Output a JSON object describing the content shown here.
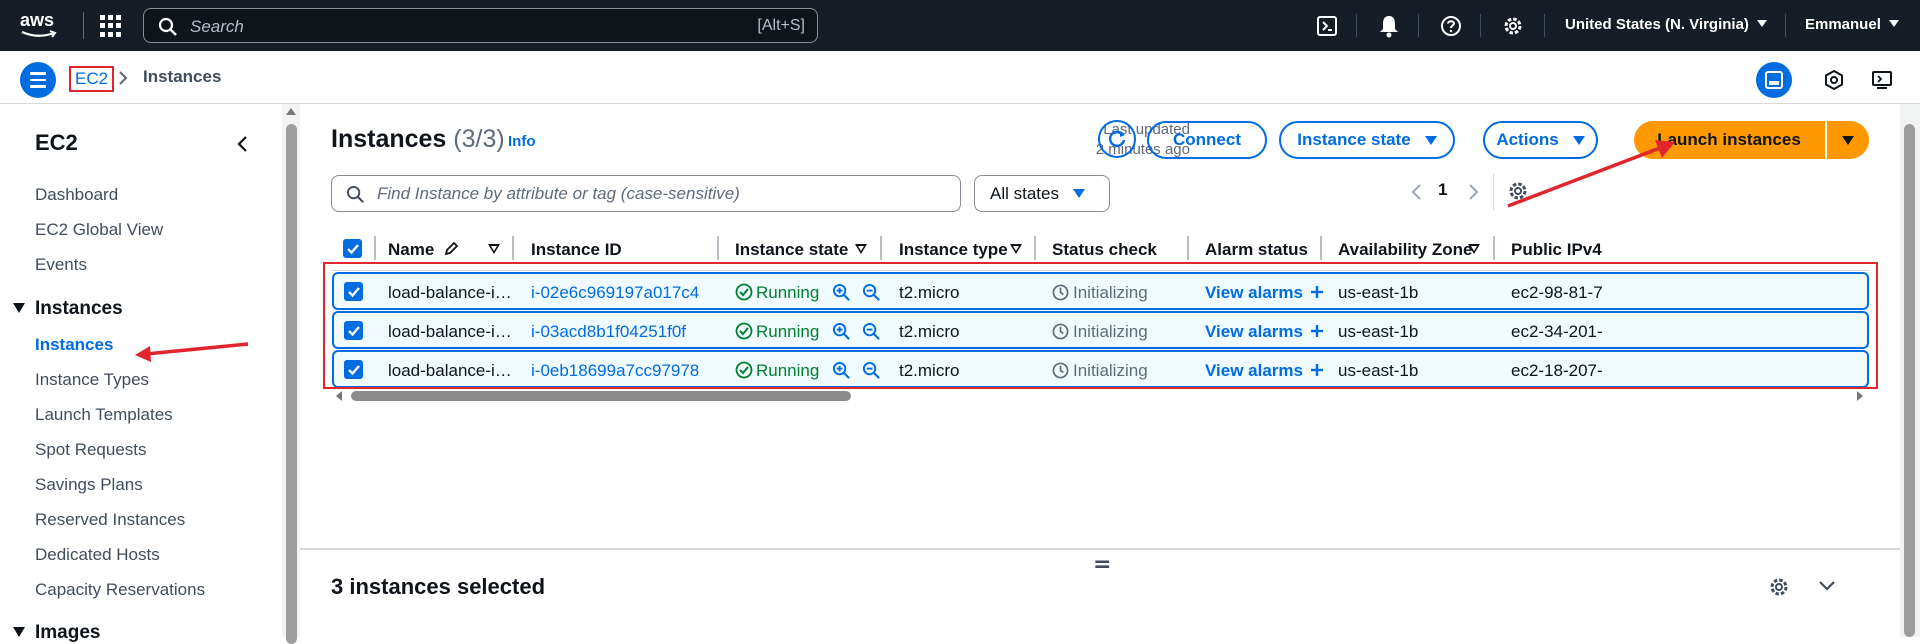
{
  "topbar": {
    "logo_text": "aws",
    "search_placeholder": "Search",
    "search_shortcut": "[Alt+S]",
    "region": "United States (N. Virginia)",
    "user": "Emmanuel"
  },
  "breadcrumb": {
    "service": "EC2",
    "current": "Instances"
  },
  "sidebar": {
    "title": "EC2",
    "items_top": [
      "Dashboard",
      "EC2 Global View",
      "Events"
    ],
    "section_instances": "Instances",
    "instances_items": [
      "Instances",
      "Instance Types",
      "Launch Templates",
      "Spot Requests",
      "Savings Plans",
      "Reserved Instances",
      "Dedicated Hosts",
      "Capacity Reservations"
    ],
    "section_images": "Images"
  },
  "header": {
    "title": "Instances",
    "count": "(3/3)",
    "info": "Info",
    "last_updated_line1": "Last updated",
    "last_updated_line2": "2 minutes ago",
    "connect": "Connect",
    "instance_state": "Instance state",
    "actions": "Actions",
    "launch": "Launch instances"
  },
  "filter": {
    "placeholder": "Find Instance by attribute or tag (case-sensitive)",
    "states": "All states"
  },
  "pagination": {
    "page": "1"
  },
  "table": {
    "columns": [
      "Name",
      "Instance ID",
      "Instance state",
      "Instance type",
      "Status check",
      "Alarm status",
      "Availability Zone",
      "Public IPv4"
    ],
    "rows": [
      {
        "name": "load-balance-i…",
        "id": "i-02e6c969197a017c4",
        "state": "Running",
        "type": "t2.micro",
        "status": "Initializing",
        "alarm": "View alarms",
        "az": "us-east-1b",
        "ipv4": "ec2-98-81-7"
      },
      {
        "name": "load-balance-i…",
        "id": "i-03acd8b1f04251f0f",
        "state": "Running",
        "type": "t2.micro",
        "status": "Initializing",
        "alarm": "View alarms",
        "az": "us-east-1b",
        "ipv4": "ec2-34-201-"
      },
      {
        "name": "load-balance-i…",
        "id": "i-0eb18699a7cc97978",
        "state": "Running",
        "type": "t2.micro",
        "status": "Initializing",
        "alarm": "View alarms",
        "az": "us-east-1b",
        "ipv4": "ec2-18-207-"
      }
    ]
  },
  "bottom_panel": {
    "title": "3 instances selected",
    "handle": "="
  },
  "colors": {
    "accent": "#006ce0",
    "launch": "#ff9900",
    "topbar": "#161d26",
    "annotation": "#e0252c",
    "running": "#00802f"
  }
}
